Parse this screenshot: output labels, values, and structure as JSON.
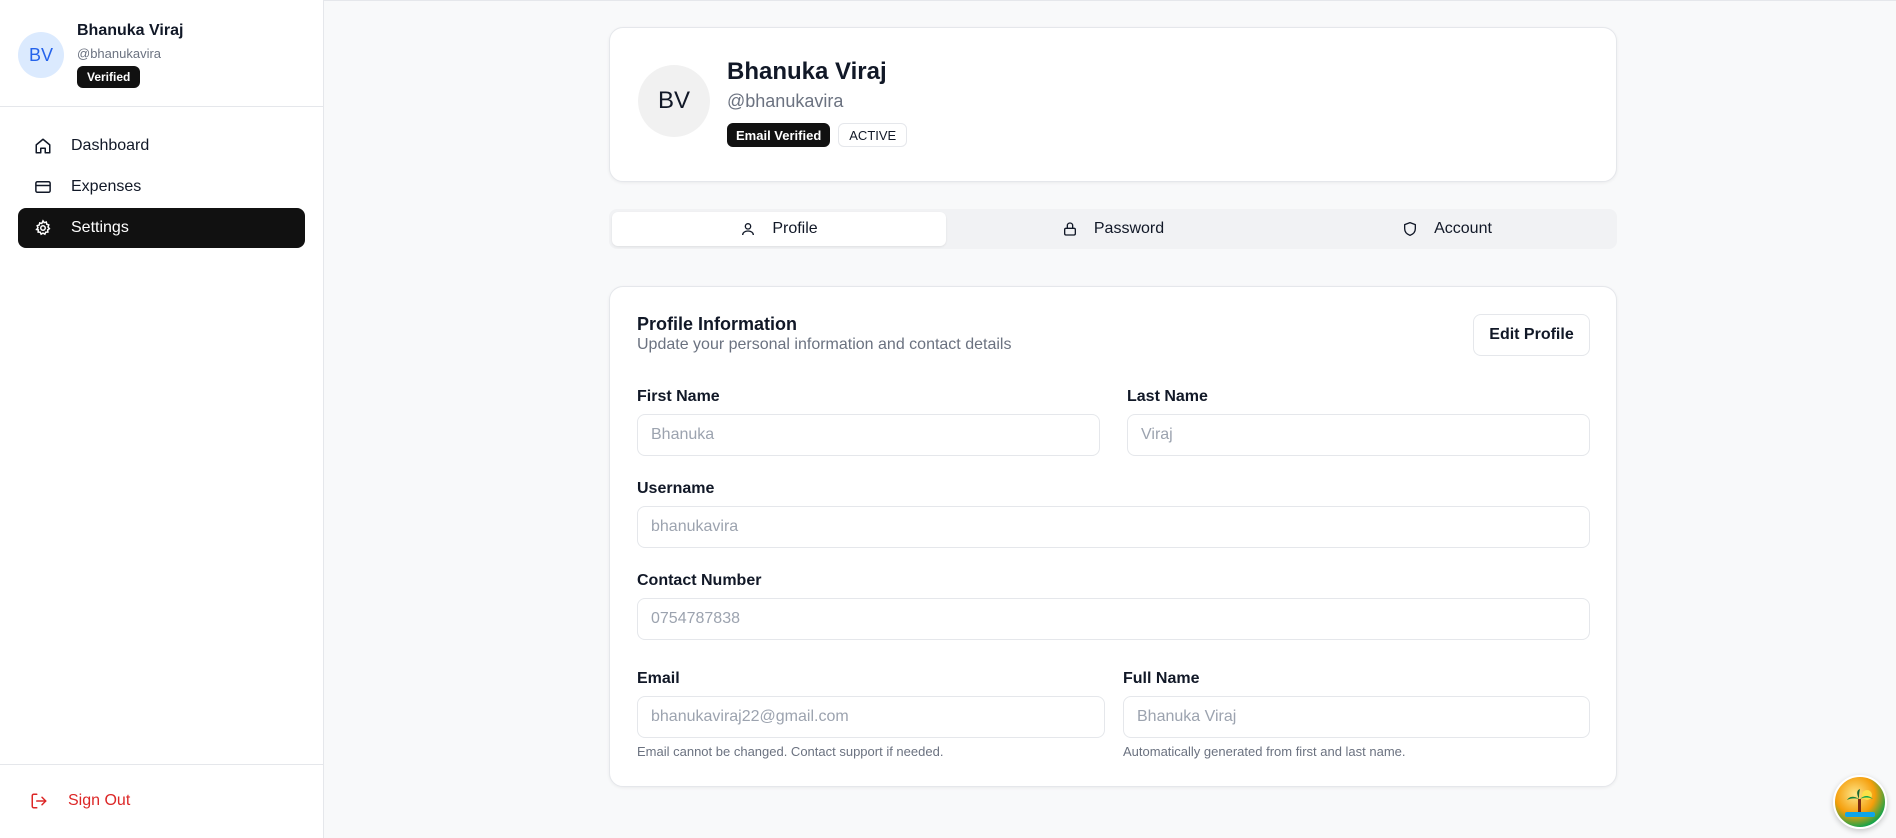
{
  "sidebar": {
    "user": {
      "initials": "BV",
      "name": "Bhanuka Viraj",
      "handle": "@bhanukavira",
      "badge": "Verified"
    },
    "nav": [
      {
        "label": "Dashboard",
        "icon": "home-icon",
        "active": false
      },
      {
        "label": "Expenses",
        "icon": "credit-card-icon",
        "active": false
      },
      {
        "label": "Settings",
        "icon": "gear-icon",
        "active": true
      }
    ],
    "signout_label": "Sign Out"
  },
  "profile": {
    "initials": "BV",
    "name": "Bhanuka Viraj",
    "handle": "@bhanukavira",
    "badges": [
      "Email Verified",
      "ACTIVE"
    ]
  },
  "tabs": [
    {
      "label": "Profile",
      "icon": "user-icon",
      "active": true
    },
    {
      "label": "Password",
      "icon": "lock-icon",
      "active": false
    },
    {
      "label": "Account",
      "icon": "shield-icon",
      "active": false
    }
  ],
  "form": {
    "title": "Profile Information",
    "subtitle": "Update your personal information and contact details",
    "edit_label": "Edit Profile",
    "first_name": {
      "label": "First Name",
      "value": "Bhanuka"
    },
    "last_name": {
      "label": "Last Name",
      "value": "Viraj"
    },
    "username": {
      "label": "Username",
      "value": "bhanukavira"
    },
    "contact": {
      "label": "Contact Number",
      "value": "0754787838"
    },
    "email": {
      "label": "Email",
      "value": "bhanukaviraj22@gmail.com",
      "help": "Email cannot be changed. Contact support if needed."
    },
    "full_name": {
      "label": "Full Name",
      "value": "Bhanuka Viraj",
      "help": "Automatically generated from first and last name."
    }
  },
  "colors": {
    "accent_dark": "#111111",
    "danger": "#dc2626",
    "avatar_bg": "#dbeafe",
    "avatar_text": "#2563eb"
  }
}
